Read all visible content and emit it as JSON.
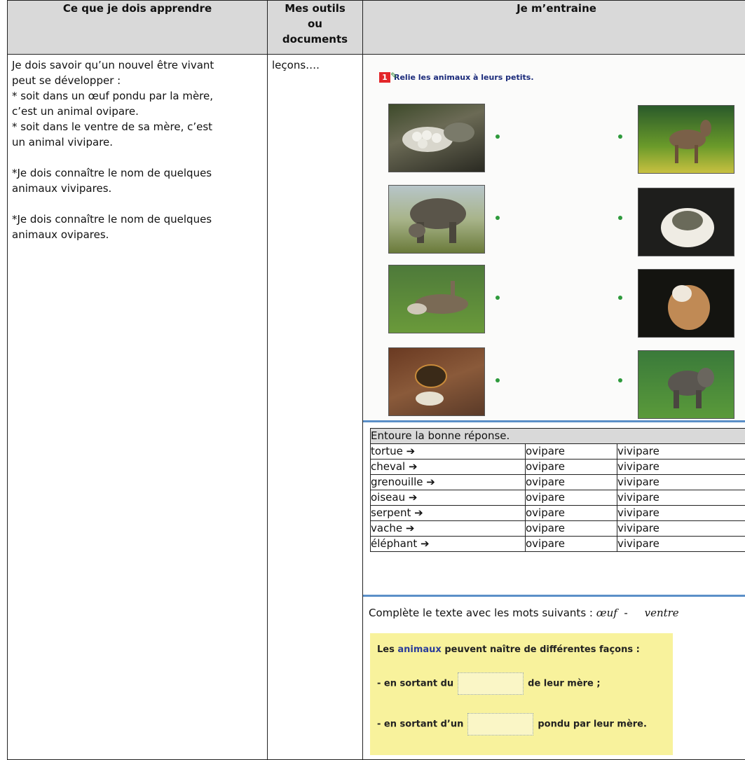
{
  "headers": {
    "col1": "Ce que je dois apprendre",
    "col2_line1": "Mes outils",
    "col2_line2": "ou",
    "col2_line3": "documents",
    "col3": "Je m’entraine"
  },
  "learn": {
    "l1": "Je dois savoir qu’un nouvel être vivant",
    "l2": "peut se développer :",
    "l3": "* soit dans un œuf pondu par la mère,",
    "l4": "c’est un animal ovipare.",
    "l5": "* soit dans le ventre de sa mère, c’est",
    "l6": "un animal vivipare.",
    "l7": "*Je dois connaître le nom de quelques",
    "l8": "animaux vivipares.",
    "l9": "*Je dois connaître le nom de quelques",
    "l10": "animaux ovipares."
  },
  "tools": {
    "text": "leçons…."
  },
  "exercise1": {
    "number": "1",
    "instruction": "Relie les animaux à leurs petits.",
    "left_photos": [
      "tortoise-eggs-photo",
      "elephant-calf-nursing-photo",
      "donkey-foal-lying-photo",
      "baby-turtle-hatching-photo"
    ],
    "right_photos": [
      "donkey-foal-photo",
      "turtle-egg-hatching-photo",
      "cracked-egg-photo",
      "baby-elephant-photo"
    ]
  },
  "exercise2": {
    "title": "Entoure la bonne réponse.",
    "arrow": "➔",
    "rows": [
      {
        "animal": "tortue",
        "a": "ovipare",
        "b": "vivipare"
      },
      {
        "animal": "cheval",
        "a": "ovipare",
        "b": "vivipare"
      },
      {
        "animal": "grenouille",
        "a": "ovipare",
        "b": "vivipare"
      },
      {
        "animal": "oiseau",
        "a": "ovipare",
        "b": "vivipare"
      },
      {
        "animal": "serpent",
        "a": "ovipare",
        "b": "vivipare"
      },
      {
        "animal": "vache",
        "a": "ovipare",
        "b": "vivipare"
      },
      {
        "animal": "éléphant",
        "a": "ovipare",
        "b": "vivipare"
      }
    ]
  },
  "exercise3": {
    "instruction": "Complète le texte avec les mots suivants :",
    "word1": "œuf",
    "dash": "-",
    "word2": "ventre",
    "box_line1_a": "Les",
    "box_line1_b": "animaux",
    "box_line1_c": "peuvent naître de différentes façons :",
    "box_line2_a": "- en sortant du",
    "box_line2_b": "de leur mère ;",
    "box_line3_a": "- en sortant d’un",
    "box_line3_b": "pondu par leur mère."
  },
  "colors": {
    "header_bg": "#d9d9d9",
    "number_badge": "#e3262a",
    "dot_green": "#2e9a3c",
    "separator_blue": "#5b8fc8",
    "box_yellow": "#f8f29c"
  }
}
